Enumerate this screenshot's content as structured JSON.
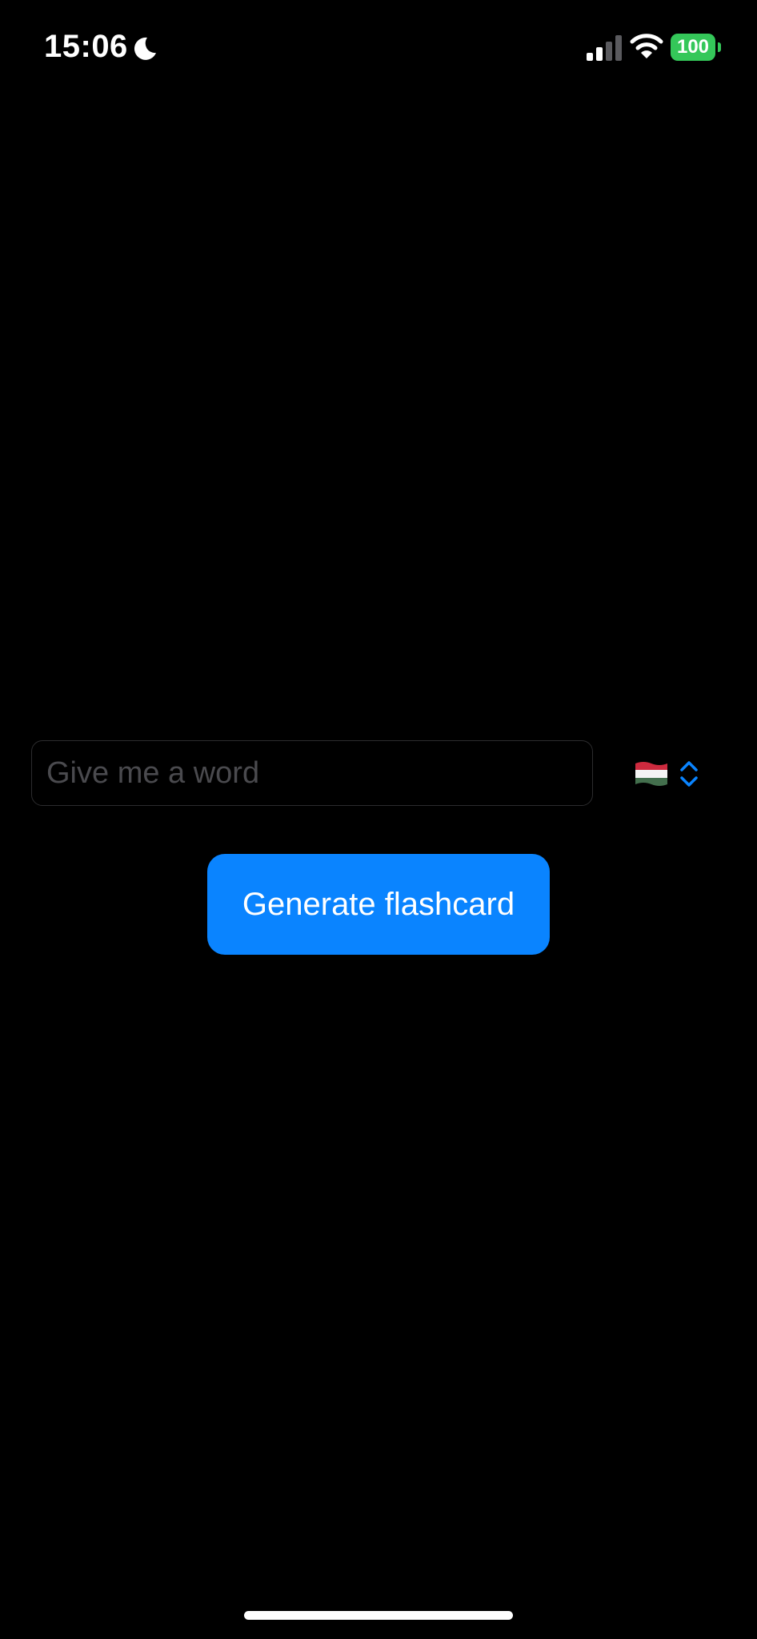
{
  "status_bar": {
    "time": "15:06",
    "focus_icon": "moon-icon",
    "signal_icon": "cellular-signal-icon",
    "wifi_icon": "wifi-icon",
    "battery_level": "100",
    "battery_color": "#34c759"
  },
  "main": {
    "word_input": {
      "placeholder": "Give me a word",
      "value": ""
    },
    "language_picker": {
      "selected_flag": "🇭🇺",
      "flag_icon": "hungary-flag-icon",
      "chevron_icon": "chevron-up-down-icon",
      "accent_color": "#0a84ff"
    },
    "generate_button": {
      "label": "Generate flashcard",
      "color": "#0a84ff"
    }
  }
}
